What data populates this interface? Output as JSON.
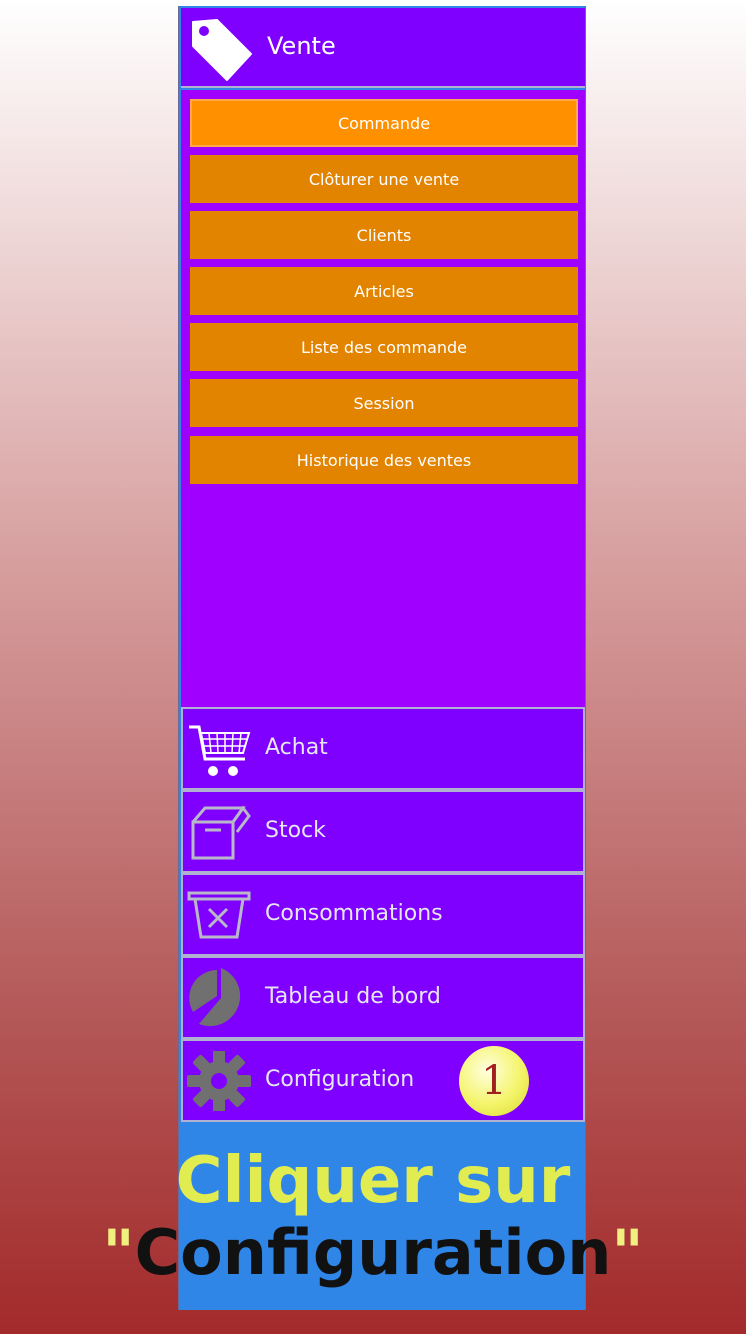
{
  "sidebar": {
    "header": {
      "label": "Vente",
      "icon": "tag-icon"
    },
    "submenu": [
      {
        "label": "Commande",
        "active": true
      },
      {
        "label": "Clôturer une vente"
      },
      {
        "label": "Clients"
      },
      {
        "label": "Articles"
      },
      {
        "label": "Liste des commande"
      },
      {
        "label": "Session"
      },
      {
        "label": "Historique des ventes"
      }
    ],
    "nav": [
      {
        "label": "Achat",
        "icon": "cart-icon"
      },
      {
        "label": "Stock",
        "icon": "box-icon"
      },
      {
        "label": "Consommations",
        "icon": "basket-x-icon"
      },
      {
        "label": "Tableau de bord",
        "icon": "pie-chart-icon"
      },
      {
        "label": "Configuration",
        "icon": "gear-icon"
      }
    ]
  },
  "callout": {
    "number": "1"
  },
  "instruction": {
    "line1": "Cliquer sur",
    "quote_open": "\"",
    "target": "Configuration",
    "quote_close": "\""
  },
  "colors": {
    "header_bg": "#8000ff",
    "submenu_bg": "#a000ff",
    "button_bg": "#e38400",
    "button_active_bg": "#ff9000",
    "instruction_line1": "#e0ec50",
    "badge": "#f4f46a"
  }
}
